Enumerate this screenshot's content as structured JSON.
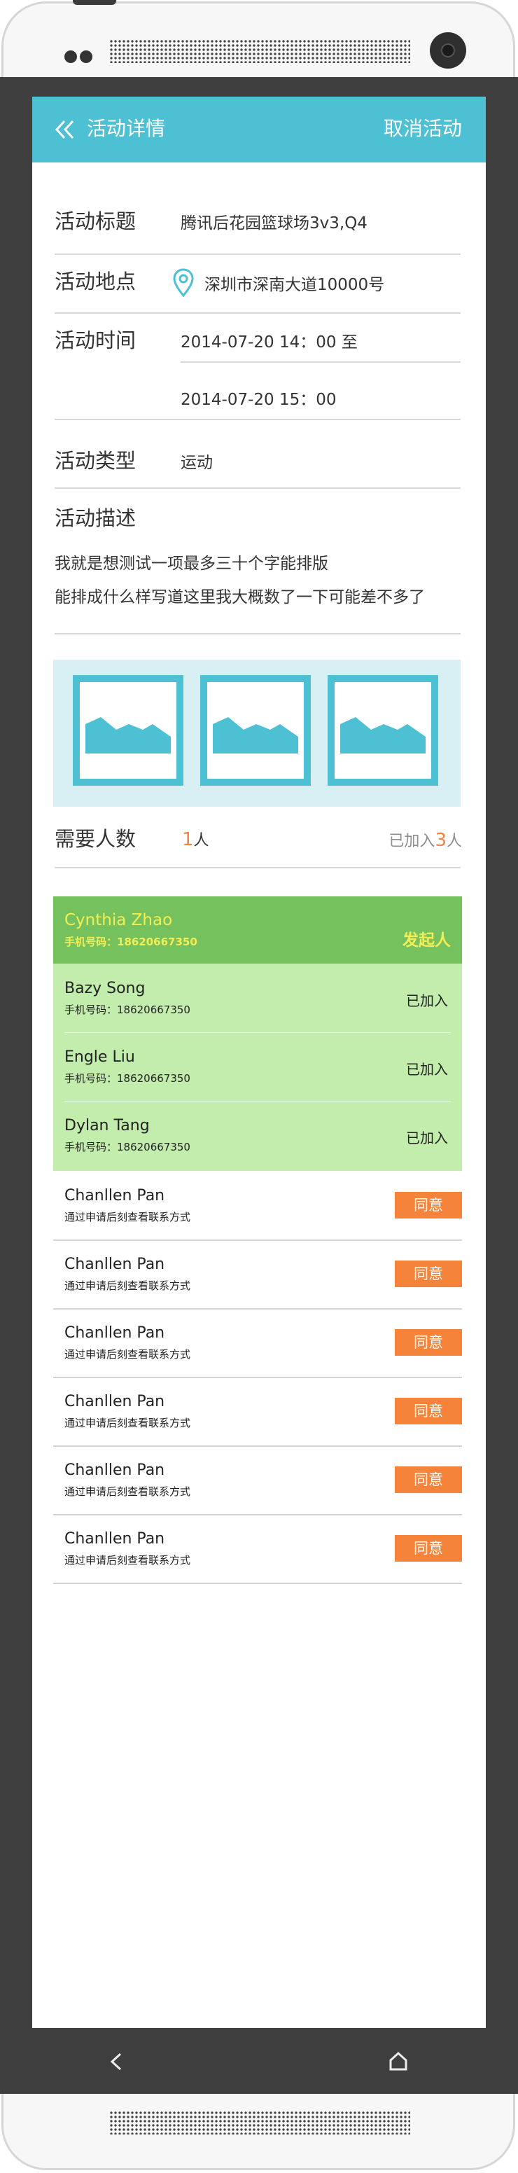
{
  "header": {
    "title": "活动详情",
    "cancel_label": "取消活动",
    "back_icon": "double-chevron-left-icon"
  },
  "details": {
    "title_label": "活动标题",
    "title_value": "腾讯后花园篮球场3v3,Q4",
    "location_label": "活动地点",
    "location_value": "深圳市深南大道10000号",
    "location_icon": "map-pin-icon",
    "time_label": "活动时间",
    "time_start": "2014-07-20 14：00 至",
    "time_end": "2014-07-20 15：00",
    "type_label": "活动类型",
    "type_value": "运动",
    "desc_label": "活动描述",
    "desc_line1": "我就是想测试一项最多三十个字能排版",
    "desc_line2": "能排成什么样写道这里我大概数了一下可能差不多了"
  },
  "images": [
    {
      "icon": "image-placeholder-icon"
    },
    {
      "icon": "image-placeholder-icon"
    },
    {
      "icon": "image-placeholder-icon"
    }
  ],
  "need": {
    "label": "需要人数",
    "count": "1",
    "unit": "人",
    "joined_prefix": "已加入",
    "joined_count": "3",
    "joined_unit": "人"
  },
  "owner": {
    "name": "Cynthia Zhao",
    "phone": "手机号码：18620667350",
    "badge": "发起人"
  },
  "joined": [
    {
      "name": "Bazy Song",
      "phone": "手机号码：18620667350",
      "status": "已加入"
    },
    {
      "name": "Engle Liu",
      "phone": "手机号码：18620667350",
      "status": "已加入"
    },
    {
      "name": "Dylan Tang",
      "phone": "手机号码：18620667350",
      "status": "已加入"
    }
  ],
  "requests": [
    {
      "name": "Chanllen Pan",
      "note": "通过申请后刻查看联系方式",
      "action": "同意"
    },
    {
      "name": "Chanllen Pan",
      "note": "通过申请后刻查看联系方式",
      "action": "同意"
    },
    {
      "name": "Chanllen Pan",
      "note": "通过申请后刻查看联系方式",
      "action": "同意"
    },
    {
      "name": "Chanllen Pan",
      "note": "通过申请后刻查看联系方式",
      "action": "同意"
    },
    {
      "name": "Chanllen Pan",
      "note": "通过申请后刻查看联系方式",
      "action": "同意"
    },
    {
      "name": "Chanllen Pan",
      "note": "通过申请后刻查看联系方式",
      "action": "同意"
    }
  ],
  "colors": {
    "accent": "#4dc0d3",
    "owner_bg": "#74c15e",
    "owner_text": "#f2ee54",
    "joined_bg": "#c2edac",
    "agree_button": "#f5843a",
    "frame": "#3f3f3f"
  },
  "system_nav": {
    "back_icon": "back-arrow-icon",
    "home_icon": "home-icon"
  }
}
